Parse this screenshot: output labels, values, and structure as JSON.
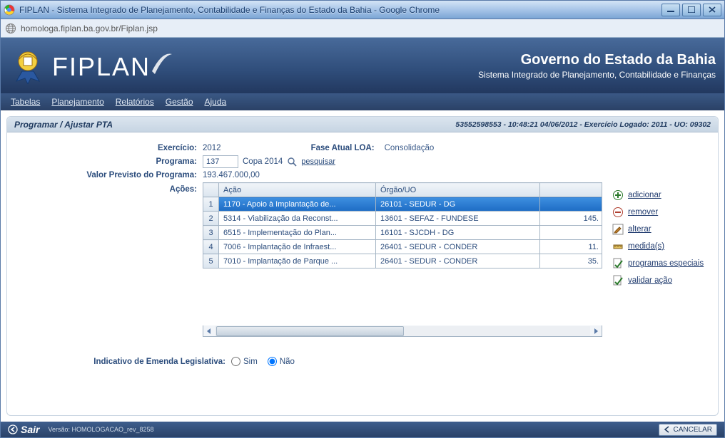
{
  "browser": {
    "title": "FIPLAN - Sistema Integrado de Planejamento, Contabilidade e Finanças do Estado da Bahia - Google Chrome",
    "url": "homologa.fiplan.ba.gov.br/Fiplan.jsp"
  },
  "header": {
    "logo_text": "FIPLAN",
    "gov_main": "Governo do Estado da Bahia",
    "gov_sub": "Sistema Integrado de Planejamento, Contabilidade e Finanças"
  },
  "menu": [
    "Tabelas",
    "Planejamento",
    "Relatórios",
    "Gestão",
    "Ajuda"
  ],
  "panel": {
    "title": "Programar / Ajustar PTA",
    "status": "53552598553 - 10:48:21 04/06/2012 - Exercício Logado: 2011 - UO: 09302"
  },
  "form": {
    "labels": {
      "exercicio": "Exercício:",
      "programa": "Programa:",
      "valor_previsto": "Valor Previsto do Programa:",
      "acoes": "Ações:",
      "fase_atual": "Fase Atual LOA:",
      "emenda": "Indicativo de Emenda Legislativa:"
    },
    "exercicio_value": "2012",
    "programa_code": "137",
    "programa_name": "Copa 2014",
    "pesquisar": "pesquisar",
    "fase_value": "Consolidação",
    "valor_previsto_value": "193.467.000,00",
    "radio": {
      "sim": "Sim",
      "nao": "Não"
    }
  },
  "grid": {
    "headers": {
      "acao": "Ação",
      "orgao": "Órgão/UO"
    },
    "rows": [
      {
        "n": "1",
        "acao": "1170 - Apoio à Implantação de...",
        "orgao": "26101 - SEDUR - DG",
        "val": "",
        "selected": true
      },
      {
        "n": "2",
        "acao": "5314 - Viabilização da Reconst...",
        "orgao": "13601 - SEFAZ - FUNDESE",
        "val": "145.",
        "selected": false
      },
      {
        "n": "3",
        "acao": "6515 - Implementação do Plan...",
        "orgao": "16101 - SJCDH - DG",
        "val": "",
        "selected": false
      },
      {
        "n": "4",
        "acao": "7006 - Implantação de Infraest...",
        "orgao": "26401 - SEDUR - CONDER",
        "val": "11.",
        "selected": false
      },
      {
        "n": "5",
        "acao": "7010 - Implantação de Parque ...",
        "orgao": "26401 - SEDUR - CONDER",
        "val": "35.",
        "selected": false
      }
    ]
  },
  "actions": {
    "adicionar": "adicionar",
    "remover": "remover",
    "alterar": "alterar",
    "medidas": "medida(s)",
    "programas": "programas especiais",
    "validar": "validar ação"
  },
  "footer": {
    "sair": "Sair",
    "version": "Versão: HOMOLOGACAO_rev_8258",
    "cancel": "CANCELAR"
  }
}
